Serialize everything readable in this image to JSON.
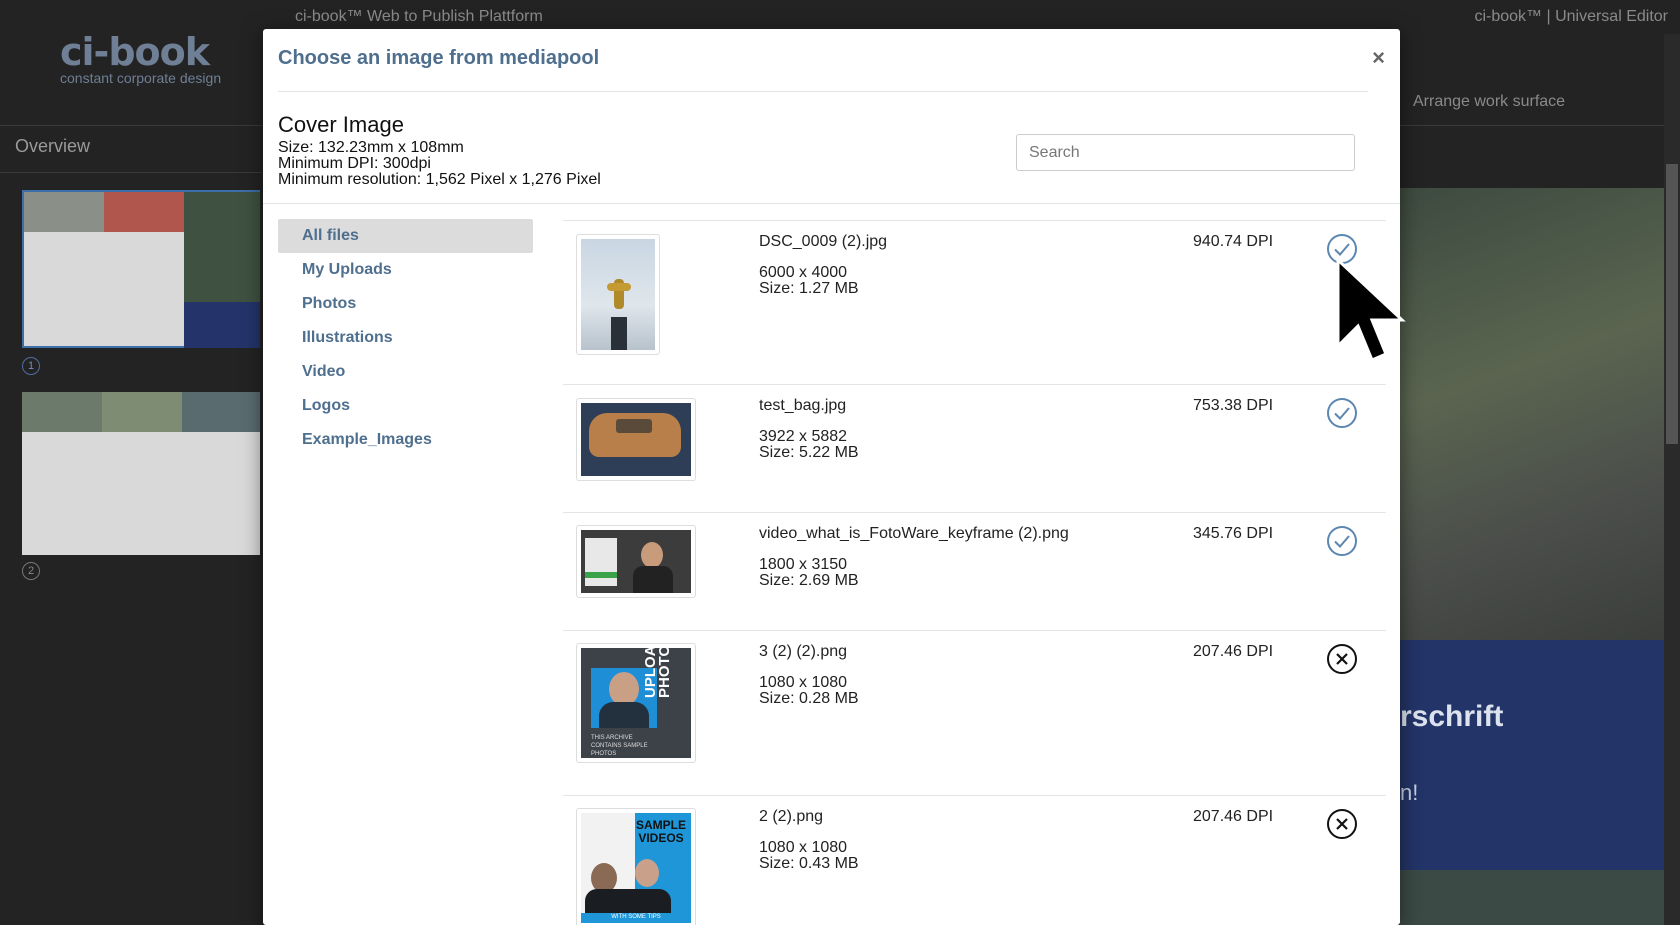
{
  "app": {
    "topbar_left": "ci-book™ Web to Publish Plattform",
    "topbar_right": "ci-book™ | Universal Editor",
    "logo_main": "ci-book",
    "logo_sub": "constant corporate design",
    "overview_label": "Overview",
    "arrange_label": "Arrange work surface",
    "page_numbers": [
      "1",
      "2"
    ],
    "canvas_heading": "rschrift",
    "canvas_sub": "n!"
  },
  "modal": {
    "title": "Choose an image from mediapool",
    "close_label": "×",
    "spec": {
      "title": "Cover Image",
      "size": "Size: 132.23mm x 108mm",
      "min_dpi": "Minimum DPI: 300dpi",
      "min_resolution": "Minimum resolution: 1,562 Pixel x 1,276 Pixel"
    },
    "search": {
      "placeholder": "Search",
      "value": ""
    },
    "nav": [
      {
        "label": "All files",
        "active": true
      },
      {
        "label": "My Uploads",
        "active": false
      },
      {
        "label": "Photos",
        "active": false
      },
      {
        "label": "Illustrations",
        "active": false
      },
      {
        "label": "Video",
        "active": false
      },
      {
        "label": "Logos",
        "active": false
      },
      {
        "label": "Example_Images",
        "active": false
      }
    ],
    "files": [
      {
        "name": "DSC_0009 (2).jpg",
        "resolution": "6000 x 4000",
        "size": "Size: 1.27 MB",
        "dpi": "940.74 DPI",
        "status": "ok"
      },
      {
        "name": "test_bag.jpg",
        "resolution": "3922 x 5882",
        "size": "Size: 5.22 MB",
        "dpi": "753.38 DPI",
        "status": "ok"
      },
      {
        "name": "video_what_is_FotoWare_keyframe (2).png",
        "resolution": "1800 x 3150",
        "size": "Size: 2.69 MB",
        "dpi": "345.76 DPI",
        "status": "ok"
      },
      {
        "name": "3 (2) (2).png",
        "resolution": "1080 x 1080",
        "size": "Size: 0.28 MB",
        "dpi": "207.46 DPI",
        "status": "fail",
        "thumb_text": "UPLOAD PHOTOS",
        "thumb_caption": "THIS ARCHIVE CONTAINS SAMPLE PHOTOS"
      },
      {
        "name": "2 (2).png",
        "resolution": "1080 x 1080",
        "size": "Size: 0.43 MB",
        "dpi": "207.46 DPI",
        "status": "fail",
        "thumb_text": "SAMPLE VIDEOS",
        "thumb_caption": "WITH SOME TIPS"
      }
    ],
    "colors": {
      "accent": "#4f6f8f",
      "ok": "#5b87b0",
      "fail": "#111111"
    }
  }
}
